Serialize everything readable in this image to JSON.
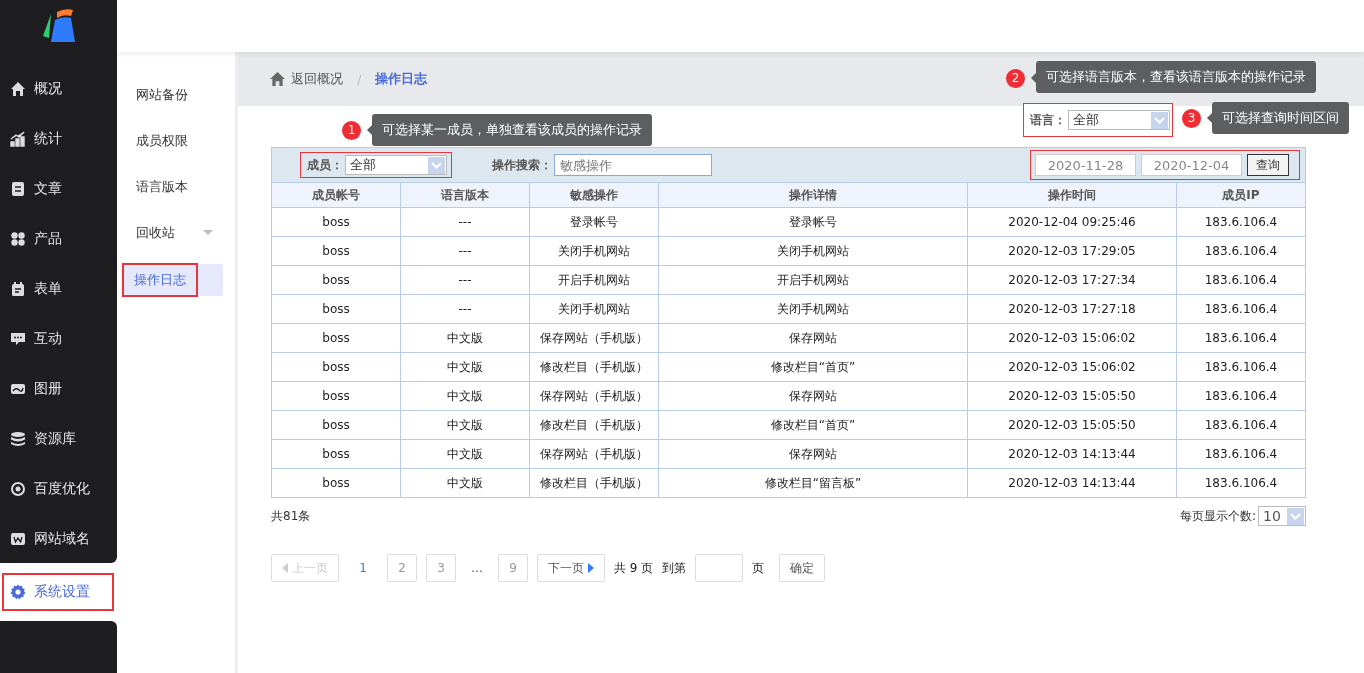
{
  "nav": [
    {
      "label": "概况",
      "selected": false
    },
    {
      "label": "统计",
      "selected": false
    },
    {
      "label": "文章",
      "selected": false
    },
    {
      "label": "产品",
      "selected": false
    },
    {
      "label": "表单",
      "selected": false
    },
    {
      "label": "互动",
      "selected": false
    },
    {
      "label": "图册",
      "selected": false
    },
    {
      "label": "资源库",
      "selected": false
    },
    {
      "label": "百度优化",
      "selected": false
    },
    {
      "label": "网站域名",
      "selected": false
    },
    {
      "label": "系统设置",
      "selected": true,
      "highlighted": true
    }
  ],
  "subnav": [
    {
      "label": "网站备份",
      "selected": false,
      "expandable": false,
      "highlighted": false
    },
    {
      "label": "成员权限",
      "selected": false,
      "expandable": false,
      "highlighted": false
    },
    {
      "label": "语言版本",
      "selected": false,
      "expandable": false,
      "highlighted": false
    },
    {
      "label": "回收站",
      "selected": false,
      "expandable": true,
      "highlighted": false
    },
    {
      "label": "操作日志",
      "selected": true,
      "expandable": false,
      "highlighted": true
    }
  ],
  "breadcrumb": {
    "back": "返回概况",
    "separator": "/",
    "current": "操作日志"
  },
  "tips": [
    {
      "number": "1",
      "text": "可选择某一成员，单独查看该成员的操作记录"
    },
    {
      "number": "2",
      "text": "可选择语言版本，查看该语言版本的操作记录"
    },
    {
      "number": "3",
      "text": "可选择查询时间区间"
    }
  ],
  "language_filter": {
    "label": "语言：",
    "value": "全部",
    "highlighted": true
  },
  "member_filter": {
    "label": "成员：",
    "value": "全部",
    "highlighted": true
  },
  "search": {
    "label": "操作搜索：",
    "placeholder": "敏感操作"
  },
  "date_range": {
    "start": "2020-11-28",
    "end": "2020-12-04",
    "button": "查询",
    "highlighted": true
  },
  "table": {
    "columns": [
      "成员帐号",
      "语言版本",
      "敏感操作",
      "操作详情",
      "操作时间",
      "成员IP"
    ],
    "rows": [
      [
        "boss",
        "---",
        "登录帐号",
        "登录帐号",
        "2020-12-04 09:25:46",
        "183.6.106.4"
      ],
      [
        "boss",
        "---",
        "关闭手机网站",
        "关闭手机网站",
        "2020-12-03 17:29:05",
        "183.6.106.4"
      ],
      [
        "boss",
        "---",
        "开启手机网站",
        "开启手机网站",
        "2020-12-03 17:27:34",
        "183.6.106.4"
      ],
      [
        "boss",
        "---",
        "关闭手机网站",
        "关闭手机网站",
        "2020-12-03 17:27:18",
        "183.6.106.4"
      ],
      [
        "boss",
        "中文版",
        "保存网站（手机版）",
        "保存网站",
        "2020-12-03 15:06:02",
        "183.6.106.4"
      ],
      [
        "boss",
        "中文版",
        "修改栏目（手机版）",
        "修改栏目“首页”",
        "2020-12-03 15:06:02",
        "183.6.106.4"
      ],
      [
        "boss",
        "中文版",
        "保存网站（手机版）",
        "保存网站",
        "2020-12-03 15:05:50",
        "183.6.106.4"
      ],
      [
        "boss",
        "中文版",
        "修改栏目（手机版）",
        "修改栏目“首页”",
        "2020-12-03 15:05:50",
        "183.6.106.4"
      ],
      [
        "boss",
        "中文版",
        "保存网站（手机版）",
        "保存网站",
        "2020-12-03 14:13:44",
        "183.6.106.4"
      ],
      [
        "boss",
        "中文版",
        "修改栏目（手机版）",
        "修改栏目“留言板”",
        "2020-12-03 14:13:44",
        "183.6.106.4"
      ]
    ]
  },
  "total": "共81条",
  "page_size": {
    "label": "每页显示个数:",
    "value": "10"
  },
  "pagination": {
    "prev": {
      "label": "上一页",
      "disabled": true
    },
    "pages": [
      {
        "label": "1",
        "selected": true
      },
      {
        "label": "2",
        "selected": false
      },
      {
        "label": "3",
        "selected": false
      },
      {
        "label": "…",
        "kind": "ellipsis",
        "selected": false
      },
      {
        "label": "9",
        "selected": false
      }
    ],
    "next": {
      "label": "下一页",
      "disabled": false
    },
    "total_pages": "共 9 页",
    "goto_label": "到第",
    "goto_suffix": "页",
    "confirm": "确定"
  }
}
